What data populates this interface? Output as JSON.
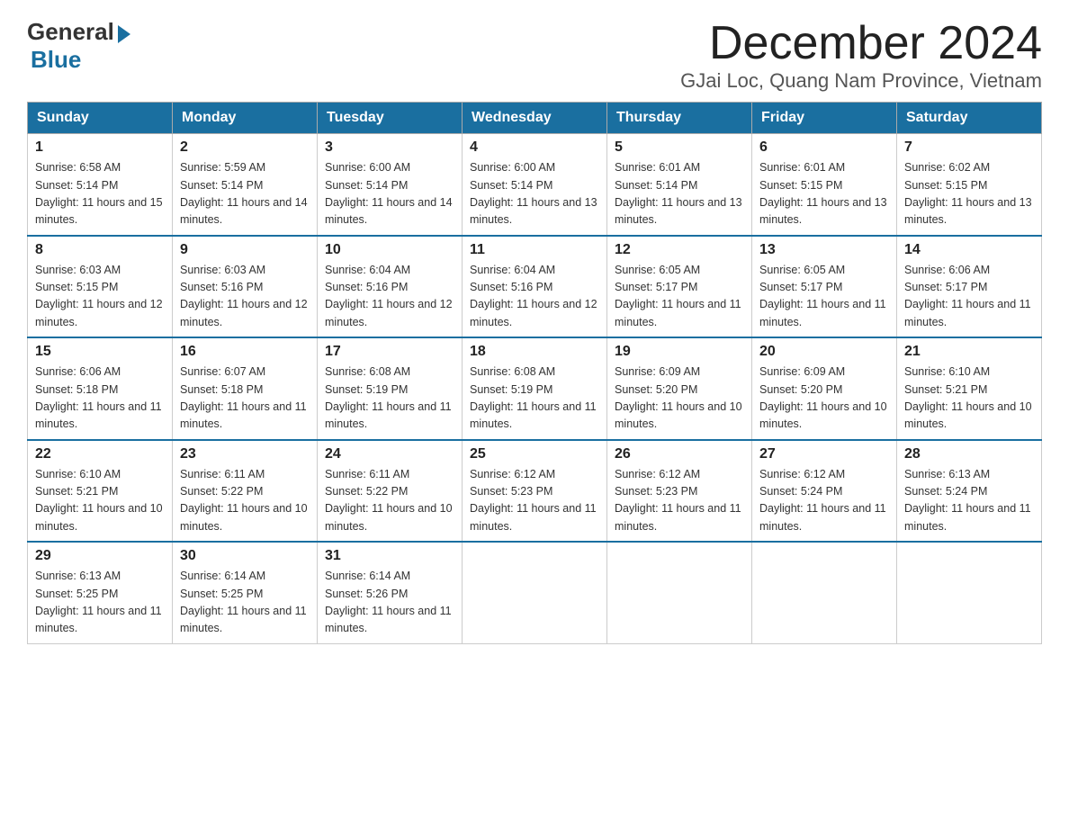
{
  "logo": {
    "general": "General",
    "blue": "Blue"
  },
  "title": "December 2024",
  "subtitle": "GJai Loc, Quang Nam Province, Vietnam",
  "headers": [
    "Sunday",
    "Monday",
    "Tuesday",
    "Wednesday",
    "Thursday",
    "Friday",
    "Saturday"
  ],
  "weeks": [
    [
      {
        "day": "1",
        "sunrise": "6:58 AM",
        "sunset": "5:14 PM",
        "daylight": "11 hours and 15 minutes."
      },
      {
        "day": "2",
        "sunrise": "5:59 AM",
        "sunset": "5:14 PM",
        "daylight": "11 hours and 14 minutes."
      },
      {
        "day": "3",
        "sunrise": "6:00 AM",
        "sunset": "5:14 PM",
        "daylight": "11 hours and 14 minutes."
      },
      {
        "day": "4",
        "sunrise": "6:00 AM",
        "sunset": "5:14 PM",
        "daylight": "11 hours and 13 minutes."
      },
      {
        "day": "5",
        "sunrise": "6:01 AM",
        "sunset": "5:14 PM",
        "daylight": "11 hours and 13 minutes."
      },
      {
        "day": "6",
        "sunrise": "6:01 AM",
        "sunset": "5:15 PM",
        "daylight": "11 hours and 13 minutes."
      },
      {
        "day": "7",
        "sunrise": "6:02 AM",
        "sunset": "5:15 PM",
        "daylight": "11 hours and 13 minutes."
      }
    ],
    [
      {
        "day": "8",
        "sunrise": "6:03 AM",
        "sunset": "5:15 PM",
        "daylight": "11 hours and 12 minutes."
      },
      {
        "day": "9",
        "sunrise": "6:03 AM",
        "sunset": "5:16 PM",
        "daylight": "11 hours and 12 minutes."
      },
      {
        "day": "10",
        "sunrise": "6:04 AM",
        "sunset": "5:16 PM",
        "daylight": "11 hours and 12 minutes."
      },
      {
        "day": "11",
        "sunrise": "6:04 AM",
        "sunset": "5:16 PM",
        "daylight": "11 hours and 12 minutes."
      },
      {
        "day": "12",
        "sunrise": "6:05 AM",
        "sunset": "5:17 PM",
        "daylight": "11 hours and 11 minutes."
      },
      {
        "day": "13",
        "sunrise": "6:05 AM",
        "sunset": "5:17 PM",
        "daylight": "11 hours and 11 minutes."
      },
      {
        "day": "14",
        "sunrise": "6:06 AM",
        "sunset": "5:17 PM",
        "daylight": "11 hours and 11 minutes."
      }
    ],
    [
      {
        "day": "15",
        "sunrise": "6:06 AM",
        "sunset": "5:18 PM",
        "daylight": "11 hours and 11 minutes."
      },
      {
        "day": "16",
        "sunrise": "6:07 AM",
        "sunset": "5:18 PM",
        "daylight": "11 hours and 11 minutes."
      },
      {
        "day": "17",
        "sunrise": "6:08 AM",
        "sunset": "5:19 PM",
        "daylight": "11 hours and 11 minutes."
      },
      {
        "day": "18",
        "sunrise": "6:08 AM",
        "sunset": "5:19 PM",
        "daylight": "11 hours and 11 minutes."
      },
      {
        "day": "19",
        "sunrise": "6:09 AM",
        "sunset": "5:20 PM",
        "daylight": "11 hours and 10 minutes."
      },
      {
        "day": "20",
        "sunrise": "6:09 AM",
        "sunset": "5:20 PM",
        "daylight": "11 hours and 10 minutes."
      },
      {
        "day": "21",
        "sunrise": "6:10 AM",
        "sunset": "5:21 PM",
        "daylight": "11 hours and 10 minutes."
      }
    ],
    [
      {
        "day": "22",
        "sunrise": "6:10 AM",
        "sunset": "5:21 PM",
        "daylight": "11 hours and 10 minutes."
      },
      {
        "day": "23",
        "sunrise": "6:11 AM",
        "sunset": "5:22 PM",
        "daylight": "11 hours and 10 minutes."
      },
      {
        "day": "24",
        "sunrise": "6:11 AM",
        "sunset": "5:22 PM",
        "daylight": "11 hours and 10 minutes."
      },
      {
        "day": "25",
        "sunrise": "6:12 AM",
        "sunset": "5:23 PM",
        "daylight": "11 hours and 11 minutes."
      },
      {
        "day": "26",
        "sunrise": "6:12 AM",
        "sunset": "5:23 PM",
        "daylight": "11 hours and 11 minutes."
      },
      {
        "day": "27",
        "sunrise": "6:12 AM",
        "sunset": "5:24 PM",
        "daylight": "11 hours and 11 minutes."
      },
      {
        "day": "28",
        "sunrise": "6:13 AM",
        "sunset": "5:24 PM",
        "daylight": "11 hours and 11 minutes."
      }
    ],
    [
      {
        "day": "29",
        "sunrise": "6:13 AM",
        "sunset": "5:25 PM",
        "daylight": "11 hours and 11 minutes."
      },
      {
        "day": "30",
        "sunrise": "6:14 AM",
        "sunset": "5:25 PM",
        "daylight": "11 hours and 11 minutes."
      },
      {
        "day": "31",
        "sunrise": "6:14 AM",
        "sunset": "5:26 PM",
        "daylight": "11 hours and 11 minutes."
      },
      null,
      null,
      null,
      null
    ]
  ],
  "day_label": "Sunrise: {sunrise}\nSunset: {sunset}\nDaylight: {daylight}"
}
